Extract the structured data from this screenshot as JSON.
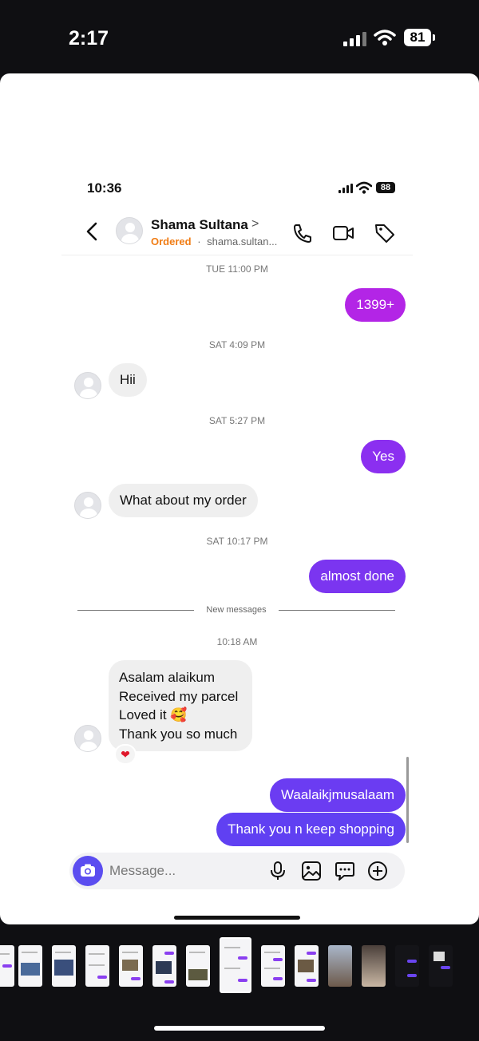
{
  "outer_status": {
    "time": "2:17",
    "battery": "81"
  },
  "inner_status": {
    "time": "10:36",
    "battery": "88"
  },
  "header": {
    "name": "Shama Sultana",
    "name_chevron": ">",
    "status": "Ordered",
    "separator": "·",
    "username": "shama.sultan..."
  },
  "conversation": {
    "timestamps": [
      "TUE 11:00 PM",
      "SAT 4:09 PM",
      "SAT 5:27 PM",
      "SAT 10:17 PM",
      "10:18 AM"
    ],
    "messages": [
      {
        "from": "me",
        "text": "1399+",
        "color": "#b325e6"
      },
      {
        "from": "them",
        "text": "Hii"
      },
      {
        "from": "me",
        "text": "Yes",
        "color": "#8b2ff0"
      },
      {
        "from": "them",
        "text": "What about my order"
      },
      {
        "from": "me",
        "text": "almost done",
        "color": "#7b35f0"
      },
      {
        "from": "them",
        "lines": [
          "Asalam alaikum",
          "Received my parcel",
          "Loved it 🥰",
          "Thank you so much"
        ],
        "reaction": "❤"
      },
      {
        "from": "me",
        "text": "Waalaikjmusalaam",
        "color": "#6b3cf2"
      },
      {
        "from": "me",
        "text": "Thank you n keep shopping",
        "color": "#6040f2"
      }
    ],
    "new_messages_label": "New messages"
  },
  "composer": {
    "placeholder": "Message..."
  },
  "colors": {
    "accent": "#5b4df0",
    "ordered": "#f07c14"
  },
  "icons": [
    "back-icon",
    "phone-icon",
    "video-icon",
    "tag-icon",
    "camera-icon",
    "microphone-icon",
    "image-icon",
    "sticker-icon",
    "plus-icon"
  ]
}
